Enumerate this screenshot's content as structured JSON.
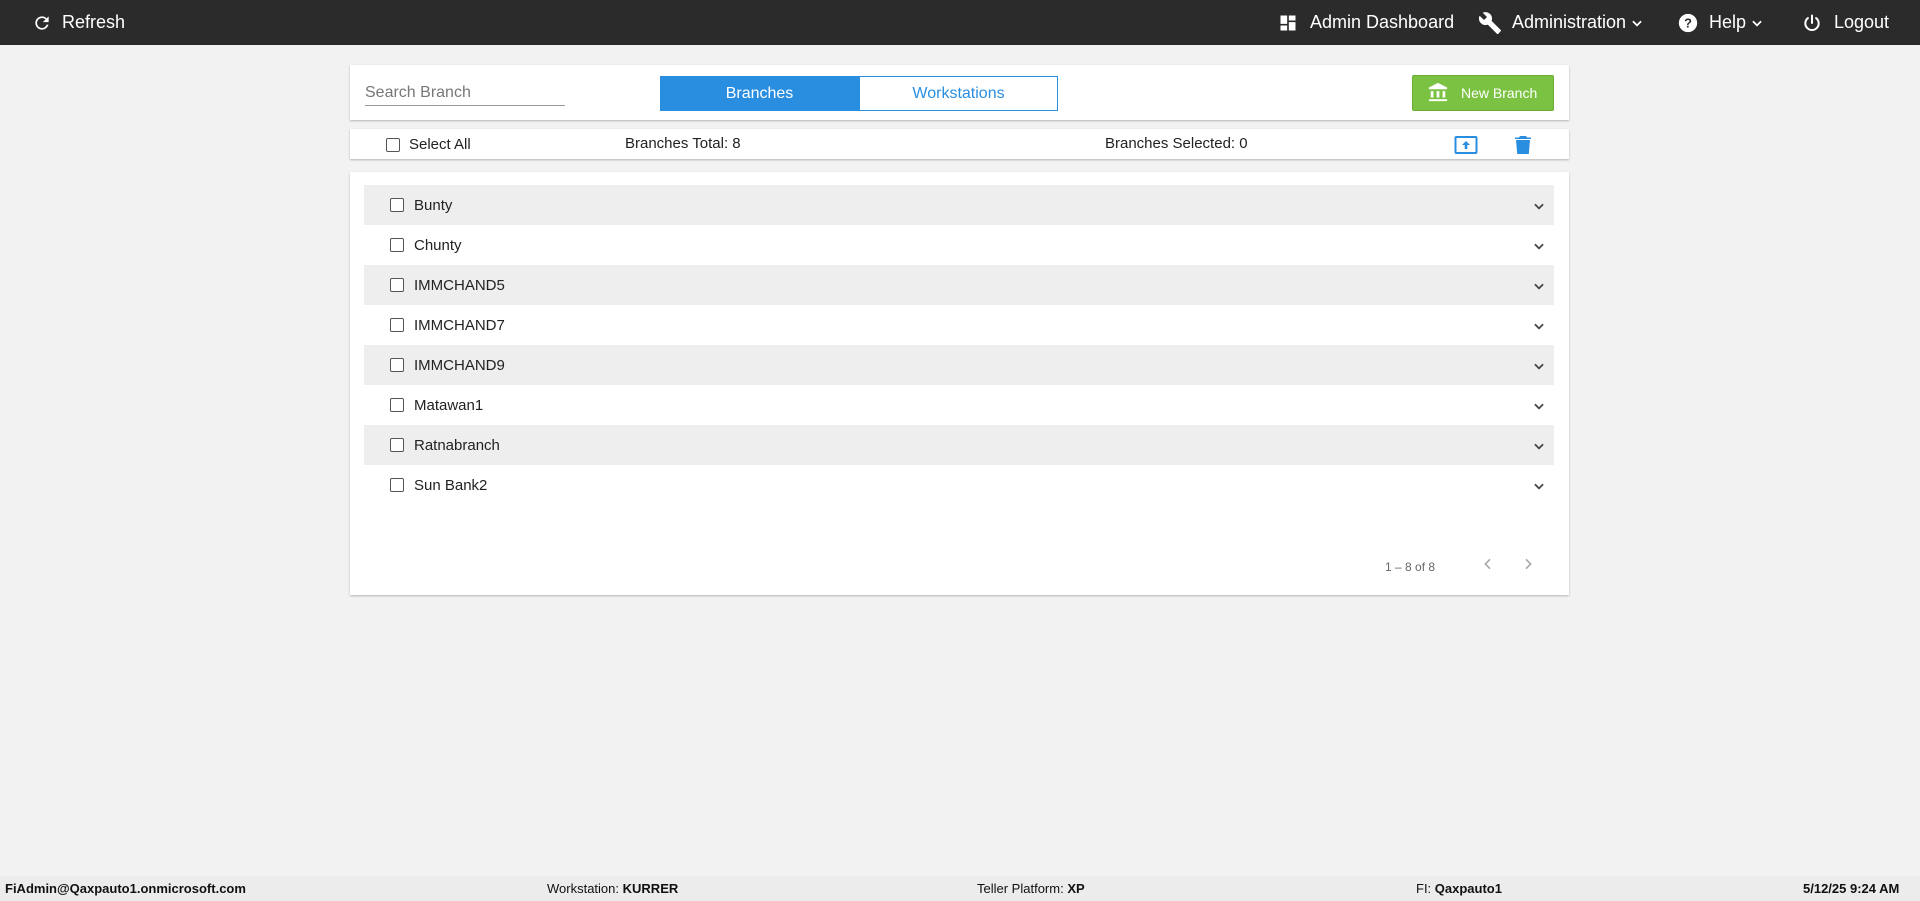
{
  "topbar": {
    "refresh_label": "Refresh",
    "admin_dashboard_label": "Admin Dashboard",
    "administration_label": "Administration",
    "help_label": "Help",
    "logout_label": "Logout"
  },
  "header": {
    "search_placeholder": "Search Branch",
    "search_value": "",
    "tabs": [
      {
        "label": "Branches",
        "active": true
      },
      {
        "label": "Workstations",
        "active": false
      }
    ],
    "new_branch_label": "New Branch"
  },
  "summary": {
    "select_all_label": "Select All",
    "branches_total": "Branches Total: 8",
    "branches_selected": "Branches Selected: 0"
  },
  "branches": [
    {
      "name": "Bunty"
    },
    {
      "name": "Chunty"
    },
    {
      "name": "IMMCHAND5"
    },
    {
      "name": "IMMCHAND7"
    },
    {
      "name": "IMMCHAND9"
    },
    {
      "name": "Matawan1"
    },
    {
      "name": "Ratnabranch"
    },
    {
      "name": "Sun Bank2"
    }
  ],
  "pagination": {
    "range_label": "1 – 8 of 8"
  },
  "footer": {
    "user": "FiAdmin@Qaxpauto1.onmicrosoft.com",
    "workstation_label": "Workstation:",
    "workstation_value": "KURRER",
    "platform_label": "Teller Platform:",
    "platform_value": "XP",
    "fi_label": "FI:",
    "fi_value": "Qaxpauto1",
    "datetime": "5/12/25 9:24 AM"
  },
  "colors": {
    "topbar_bg": "#2b2b2b",
    "accent_blue": "#2a8ee0",
    "new_branch_green": "#7cc242",
    "page_bg": "#f2f2f2",
    "row_shade": "#eeeeee"
  },
  "icons": [
    "refresh-icon",
    "dashboard-icon",
    "wrench-icon",
    "help-icon",
    "power-icon",
    "bank-icon",
    "upload-icon",
    "trash-icon",
    "chevron-down-icon",
    "chevron-left-icon",
    "chevron-right-icon"
  ]
}
